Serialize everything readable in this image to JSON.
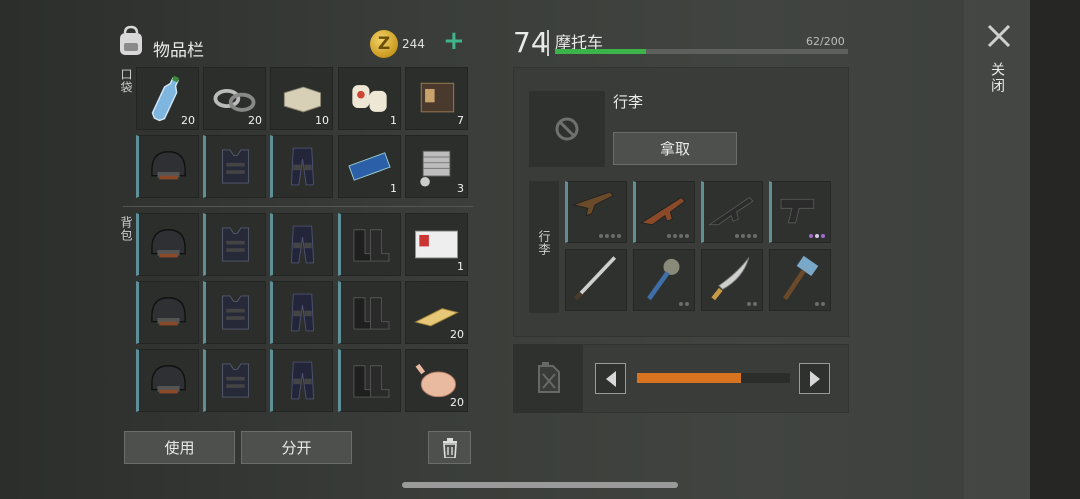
{
  "inventory": {
    "title": "物品栏",
    "coins": "244",
    "coin_symbol": "Z",
    "plus": "+",
    "pocket_label": "口袋",
    "backpack_label": "背包",
    "pockets": [
      {
        "icon": "water-bottle-icon",
        "count": "20"
      },
      {
        "icon": "tape-roll-icon",
        "count": "20"
      },
      {
        "icon": "stone-brick-icon",
        "count": "10"
      },
      {
        "icon": "first-aid-bandage-icon",
        "count": "1"
      },
      {
        "icon": "wallet-icon",
        "count": "7"
      },
      {
        "icon": "tactical-helmet-icon",
        "count": ""
      },
      {
        "icon": "armored-vest-icon",
        "count": ""
      },
      {
        "icon": "armored-pants-icon",
        "count": ""
      },
      {
        "icon": "circuit-board-icon",
        "count": "1"
      },
      {
        "icon": "engine-cylinder-icon",
        "count": "3"
      }
    ],
    "backpack": [
      {
        "icon": "tactical-helmet-icon",
        "count": ""
      },
      {
        "icon": "armored-vest-icon",
        "count": ""
      },
      {
        "icon": "armored-pants-icon",
        "count": ""
      },
      {
        "icon": "combat-boots-icon",
        "count": ""
      },
      {
        "icon": "id-card-icon",
        "count": "1"
      },
      {
        "icon": "tactical-helmet-icon",
        "count": ""
      },
      {
        "icon": "armored-vest-icon",
        "count": ""
      },
      {
        "icon": "armored-pants-icon",
        "count": ""
      },
      {
        "icon": "combat-boots-icon",
        "count": ""
      },
      {
        "icon": "gold-bar-icon",
        "count": "20"
      },
      {
        "icon": "tactical-helmet-icon",
        "count": ""
      },
      {
        "icon": "armored-vest-icon",
        "count": ""
      },
      {
        "icon": "armored-pants-icon",
        "count": ""
      },
      {
        "icon": "combat-boots-icon",
        "count": ""
      },
      {
        "icon": "roast-chicken-icon",
        "count": "20"
      }
    ],
    "use_label": "使用",
    "split_label": "分开"
  },
  "vehicle": {
    "level": "74",
    "name": "摩托车",
    "capacity_text": "62/200",
    "capacity_fraction": 0.31,
    "luggage_title": "行李",
    "take_label": "拿取",
    "luggage_side_label": "行李",
    "weapons": [
      {
        "icon": "shotgun-icon"
      },
      {
        "icon": "assault-rifle-ak-icon"
      },
      {
        "icon": "assault-rifle-m16-icon"
      },
      {
        "icon": "pistol-icon"
      },
      {
        "icon": "katana-icon"
      },
      {
        "icon": "spiked-mace-icon"
      },
      {
        "icon": "machete-icon"
      },
      {
        "icon": "sledgehammer-icon"
      }
    ],
    "fuel_fraction": 0.68
  },
  "close_label": "关闭",
  "colors": {
    "accent_green": "#3cb44a",
    "coin_gold": "#d9a92a",
    "fuel_orange": "#d8741f",
    "equip_teal": "#5f8f97",
    "plus_green": "#3fb58c"
  }
}
